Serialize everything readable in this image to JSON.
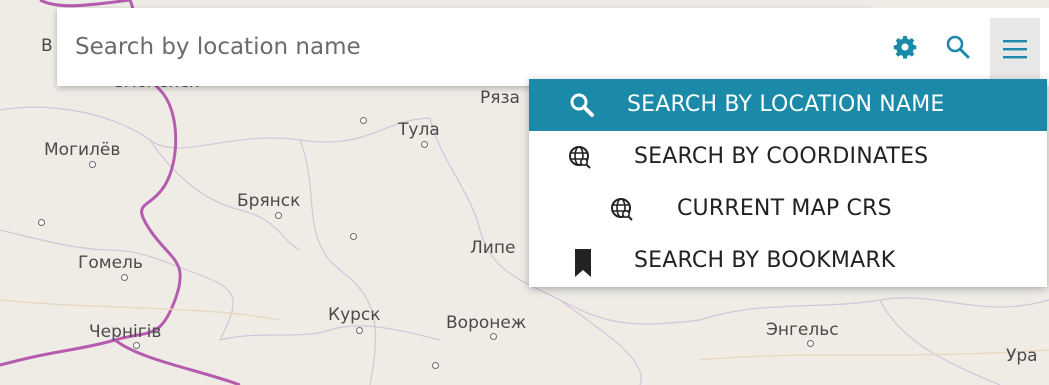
{
  "search": {
    "placeholder": "Search by location name"
  },
  "toolbar": {
    "settings_icon": "gear-icon",
    "search_icon": "search-icon",
    "menu_icon": "hamburger-icon"
  },
  "menu": {
    "items": [
      {
        "label": "SEARCH BY LOCATION NAME",
        "icon": "search-icon",
        "selected": true
      },
      {
        "label": "SEARCH BY COORDINATES",
        "icon": "globe-icon"
      },
      {
        "label": "CURRENT MAP CRS",
        "icon": "globe-icon"
      },
      {
        "label": "SEARCH BY BOOKMARK",
        "icon": "bookmark-icon"
      }
    ]
  },
  "map": {
    "cities": [
      "Смоленск",
      "Могилёв",
      "Тула",
      "Ряза",
      "Брянск",
      "Гомель",
      "Липе",
      "Курск",
      "Воронеж",
      "Чернігів",
      "Энгельс",
      "Ура",
      "В"
    ]
  },
  "colors": {
    "accent": "#1a8aa8",
    "icon": "#1a8aa8",
    "border": "#b55bb0"
  }
}
